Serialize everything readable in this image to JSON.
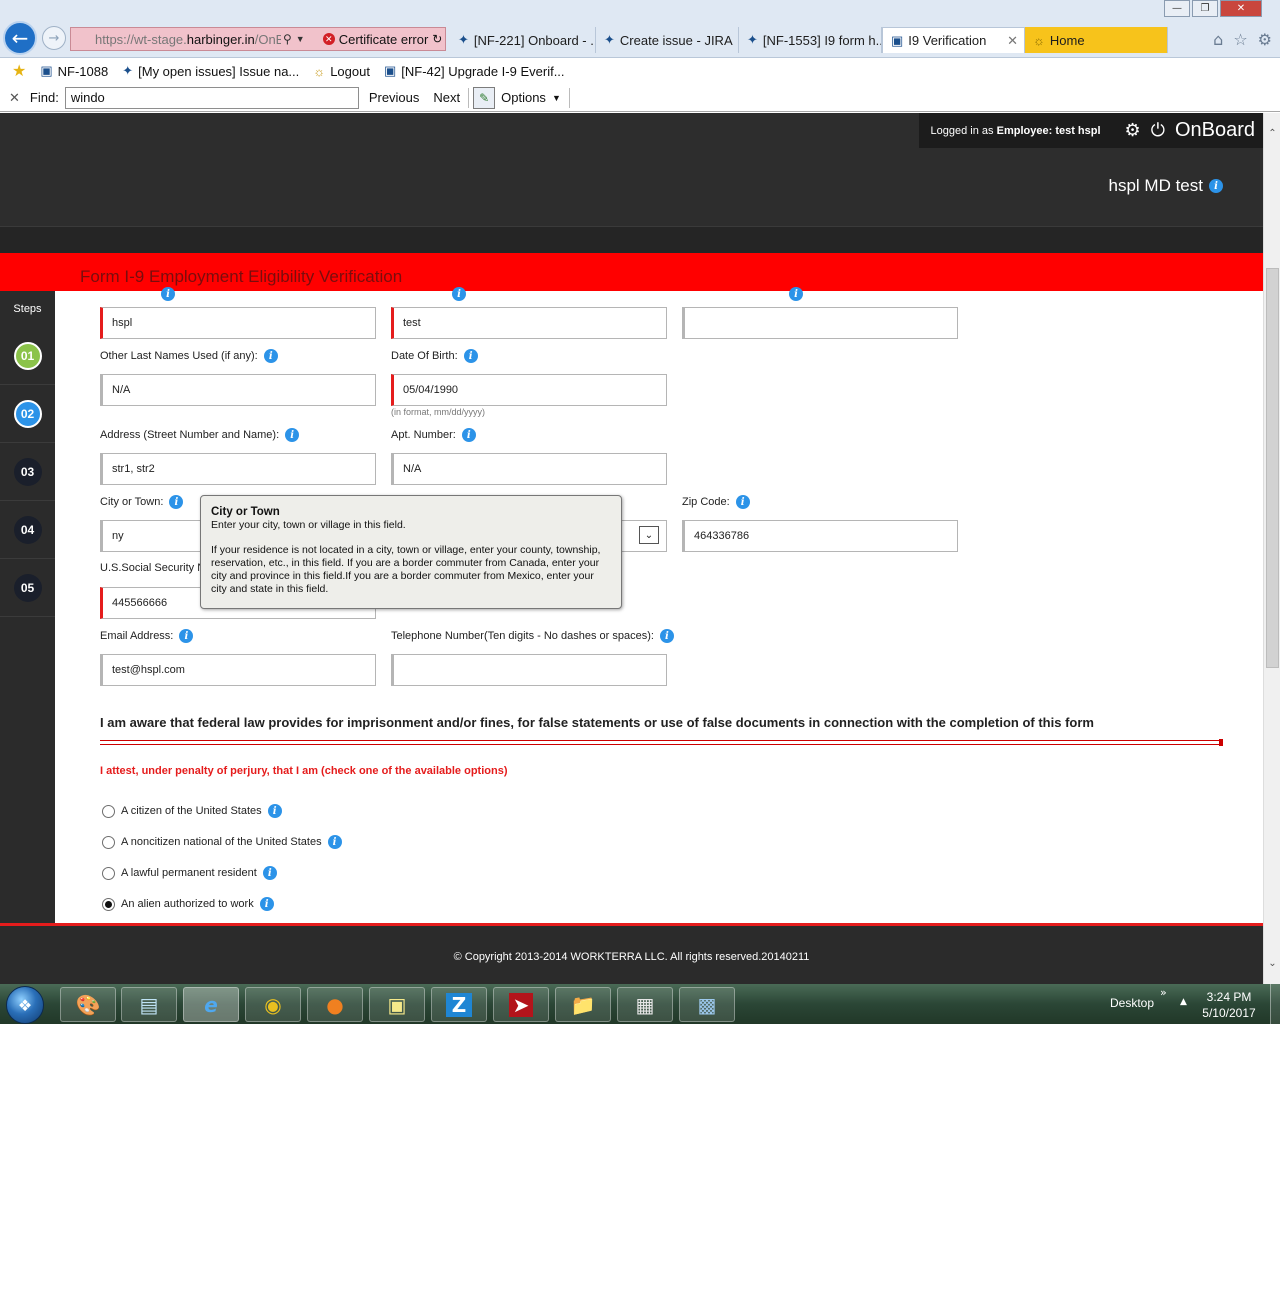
{
  "browser": {
    "url_prefix": "https://wt-stage.",
    "url_host": "harbinger.in",
    "url_suffix": "/OnBo",
    "certificate_error": "Certificate error",
    "tabs": [
      {
        "label": "[NF-221] Onboard - ..."
      },
      {
        "label": "Create issue - JIRA"
      },
      {
        "label": "[NF-1553] I9 form h..."
      },
      {
        "label": "I9 Verification"
      },
      {
        "label": "Home"
      }
    ],
    "favorites": [
      {
        "label": "NF-1088"
      },
      {
        "label": "[My open issues] Issue na..."
      },
      {
        "label": "Logout"
      },
      {
        "label": "[NF-42] Upgrade I-9 Everif..."
      }
    ],
    "find": {
      "label": "Find:",
      "value": "windo",
      "previous": "Previous",
      "next": "Next",
      "options": "Options"
    }
  },
  "app": {
    "logged_in_prefix": "Logged in as",
    "logged_in_role": "Employee:",
    "user_name": "test hspl",
    "brand": "OnBoard",
    "company": "hspl MD test",
    "form_title": "Form I-9 Employment Eligibility Verification",
    "steps_label": "Steps",
    "steps": [
      "01",
      "02",
      "03",
      "04",
      "05"
    ]
  },
  "form": {
    "last_name": "hspl",
    "first_name": "test",
    "middle_initial": "",
    "other_last_names_label": "Other Last Names Used (if any):",
    "other_last_names": "N/A",
    "dob_label": "Date Of Birth:",
    "dob": "05/04/1990",
    "dob_hint": "(in format, mm/dd/yyyy)",
    "address_label": "Address (Street Number and Name):",
    "address": "str1, str2",
    "apt_label": "Apt. Number:",
    "apt": "N/A",
    "city_label": "City or Town:",
    "city": "ny",
    "zip_label": "Zip Code:",
    "zip": "464336786",
    "ssn_label": "U.S.Social Security N",
    "ssn": "445566666",
    "email_label": "Email Address:",
    "email": "test@hspl.com",
    "phone_label": "Telephone Number(Ten digits - No dashes or spaces):",
    "phone": ""
  },
  "tooltip": {
    "title": "City or Town",
    "line1": "Enter your city, town or village in this field.",
    "line2": "If your residence is not located in a city, town or village, enter your county, township, reservation, etc., in this field. If you are a border commuter from Canada, enter your city and province in this field.If you are a border commuter from Mexico, enter your city and state in this field."
  },
  "legal": {
    "law_text": "I am aware that federal law provides for imprisonment and/or fines, for false statements or use of false documents in connection with the completion of this form",
    "attest_text": "I attest, under penalty of perjury, that I am (check one of the available options)",
    "options": [
      {
        "label": "A citizen of the United States",
        "selected": false
      },
      {
        "label": "A noncitizen national of the United States",
        "selected": false
      },
      {
        "label": "A lawful permanent resident",
        "selected": false
      },
      {
        "label": "An alien authorized to work",
        "selected": true
      }
    ]
  },
  "footer": {
    "copyright": "© Copyright 2013-2014 WORKTERRA LLC. All rights reserved.20140211"
  },
  "taskbar": {
    "desktop": "Desktop",
    "time": "3:24 PM",
    "date": "5/10/2017"
  },
  "colors": {
    "accent_red": "#ff0000",
    "header_dark": "#2d2d2d",
    "info_blue": "#2c93e8",
    "step_done": "#8bc34a"
  }
}
